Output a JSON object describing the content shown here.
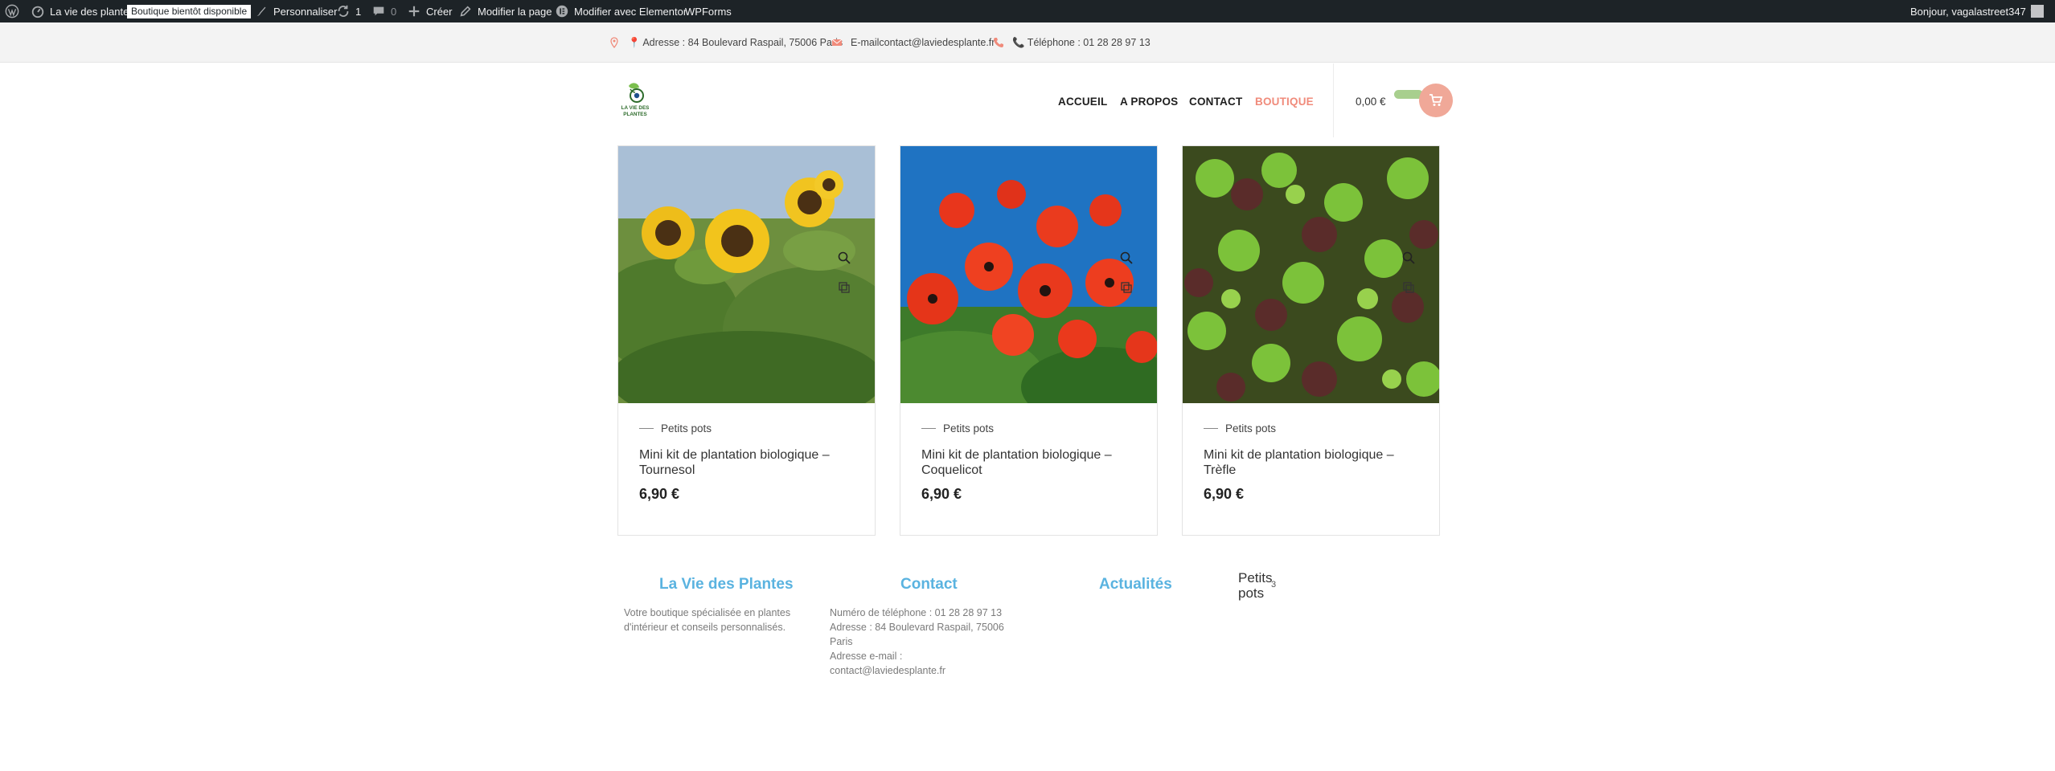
{
  "admin_bar": {
    "site_name": "La vie des plantes",
    "coming_soon_badge": "Boutique bientôt disponible",
    "customize": "Personnaliser",
    "updates_count": "1",
    "comments_count": "0",
    "create": "Créer",
    "edit_page": "Modifier la page",
    "edit_elementor": "Modifier avec Elementor",
    "wpforms": "WPForms",
    "greeting": "Bonjour, vagalastreet347"
  },
  "info_bar": {
    "address": "📍 Adresse : 84 Boulevard Raspail, 75006 Paris",
    "email": "E-mailcontact@laviedesplante.fr",
    "phone": "📞 Téléphone : 01 28 28 97 13"
  },
  "header": {
    "logo_text_line1": "LA VIE DES",
    "logo_text_line2": "PLANTES",
    "nav": [
      {
        "label": "ACCUEIL"
      },
      {
        "label": "A PROPOS"
      },
      {
        "label": "CONTACT"
      },
      {
        "label": "BOUTIQUE"
      }
    ],
    "cart_amount": "0,00 €"
  },
  "products": [
    {
      "category": "Petits pots",
      "title": "Mini kit de plantation biologique – Tournesol",
      "price": "6,90 €",
      "image": "sunflowers"
    },
    {
      "category": "Petits pots",
      "title": "Mini kit de plantation biologique – Coquelicot",
      "price": "6,90 €",
      "image": "poppies"
    },
    {
      "category": "Petits pots",
      "title": "Mini kit de plantation biologique – Trèfle",
      "price": "6,90 €",
      "image": "clover"
    }
  ],
  "footer": {
    "about": {
      "title": "La Vie des Plantes",
      "text": "Votre boutique spécialisée en plantes d'intérieur et conseils personnalisés."
    },
    "contact": {
      "title": "Contact",
      "phone": "Numéro de téléphone : 01 28 28 97 13",
      "address": "Adresse : 84 Boulevard Raspail, 75006 Paris",
      "email_label": "Adresse e-mail :",
      "email": "contact@laviedesplante.fr"
    },
    "news": {
      "title": "Actualités"
    },
    "categories": {
      "label": "Petits pots",
      "count": "3"
    }
  },
  "colors": {
    "admin_bg": "#1d2327",
    "accent_coral": "#f08b7b",
    "footer_title_blue": "#5ab3e0",
    "cart_pill_green": "#a8cf8e"
  }
}
